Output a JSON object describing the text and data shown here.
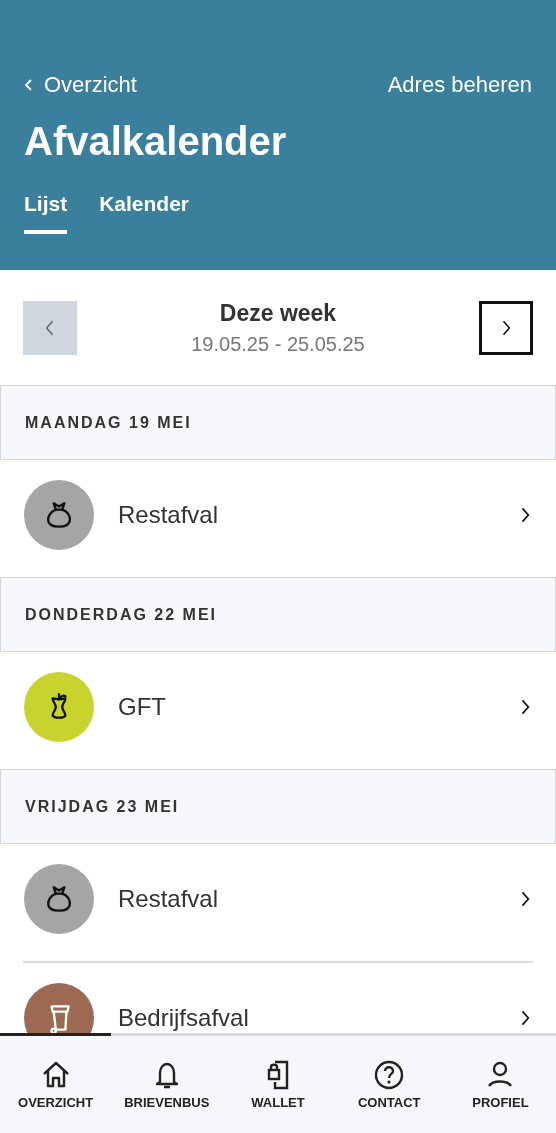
{
  "header": {
    "back_link": "Overzicht",
    "action_link": "Adres beheren",
    "title": "Afvalkalender",
    "tabs": [
      {
        "label": "Lijst",
        "selected": true
      },
      {
        "label": "Kalender",
        "selected": false
      }
    ]
  },
  "week_nav": {
    "title": "Deze week",
    "range": "19.05.25 - 25.05.25",
    "prev_disabled": true
  },
  "days": [
    {
      "label": "MAANDAG 19 MEI",
      "items": [
        {
          "name": "Restafval",
          "kind": "bag",
          "color": "#a5a5a5"
        }
      ]
    },
    {
      "label": "DONDERDAG 22 MEI",
      "items": [
        {
          "name": "GFT",
          "kind": "apple",
          "color": "#c8d32e"
        }
      ]
    },
    {
      "label": "VRIJDAG 23 MEI",
      "items": [
        {
          "name": "Restafval",
          "kind": "bag",
          "color": "#a5a5a5"
        },
        {
          "name": "Bedrijfsafval",
          "kind": "bin",
          "color": "#9c6a52"
        }
      ]
    }
  ],
  "bottom_nav": [
    {
      "label": "OVERZICHT",
      "kind": "home",
      "selected": true
    },
    {
      "label": "BRIEVENBUS",
      "kind": "bell",
      "selected": false
    },
    {
      "label": "WALLET",
      "kind": "wallet",
      "selected": false
    },
    {
      "label": "CONTACT",
      "kind": "help",
      "selected": false
    },
    {
      "label": "PROFIEL",
      "kind": "person",
      "selected": false
    }
  ]
}
